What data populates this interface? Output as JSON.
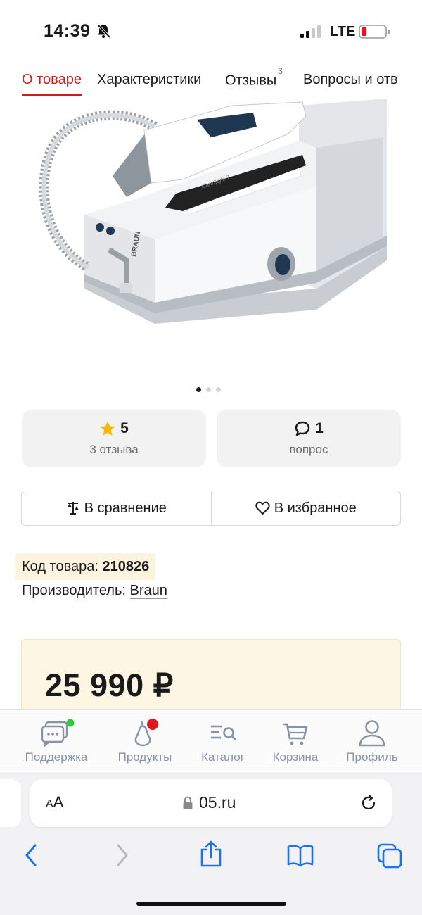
{
  "status": {
    "time": "14:39",
    "network": "LTE"
  },
  "tabs": [
    {
      "label": "О товаре"
    },
    {
      "label": "Характеристики"
    },
    {
      "label": "Отзывы",
      "count": "3"
    },
    {
      "label": "Вопросы и отв"
    }
  ],
  "product": {
    "image_icon": "steam-generator-iron-image",
    "brand_mark": "BRAUN",
    "model_mark": "CareStyle 7"
  },
  "rating_card": {
    "value": "5",
    "sub": "3 отзыва",
    "icon": "star-icon"
  },
  "questions_card": {
    "value": "1",
    "sub": "вопрос",
    "icon": "chat-bubble-icon"
  },
  "actions": {
    "compare": "В сравнение",
    "favorite": "В избранное"
  },
  "info": {
    "code_label": "Код товара:",
    "code_value": "210826",
    "maker_label": "Производитель:",
    "maker_value": "Braun"
  },
  "price": {
    "value": "25 990 ₽"
  },
  "nav": {
    "items": [
      {
        "label": "Поддержка",
        "icon": "support-chat-icon"
      },
      {
        "label": "Продукты",
        "icon": "products-pear-icon"
      },
      {
        "label": "Каталог",
        "icon": "catalog-icon"
      },
      {
        "label": "Корзина",
        "icon": "cart-icon"
      },
      {
        "label": "Профиль",
        "icon": "profile-icon"
      }
    ]
  },
  "browser": {
    "aa_small": "A",
    "aa_big": "A",
    "url": "05.ru"
  },
  "colors": {
    "accent": "#d11a1a",
    "nav_icon": "#8a93a6",
    "ios_blue": "#1a73e8",
    "badge_green": "#2ecc40",
    "badge_red": "#e0161a",
    "price_bg": "#fdf6e2"
  }
}
